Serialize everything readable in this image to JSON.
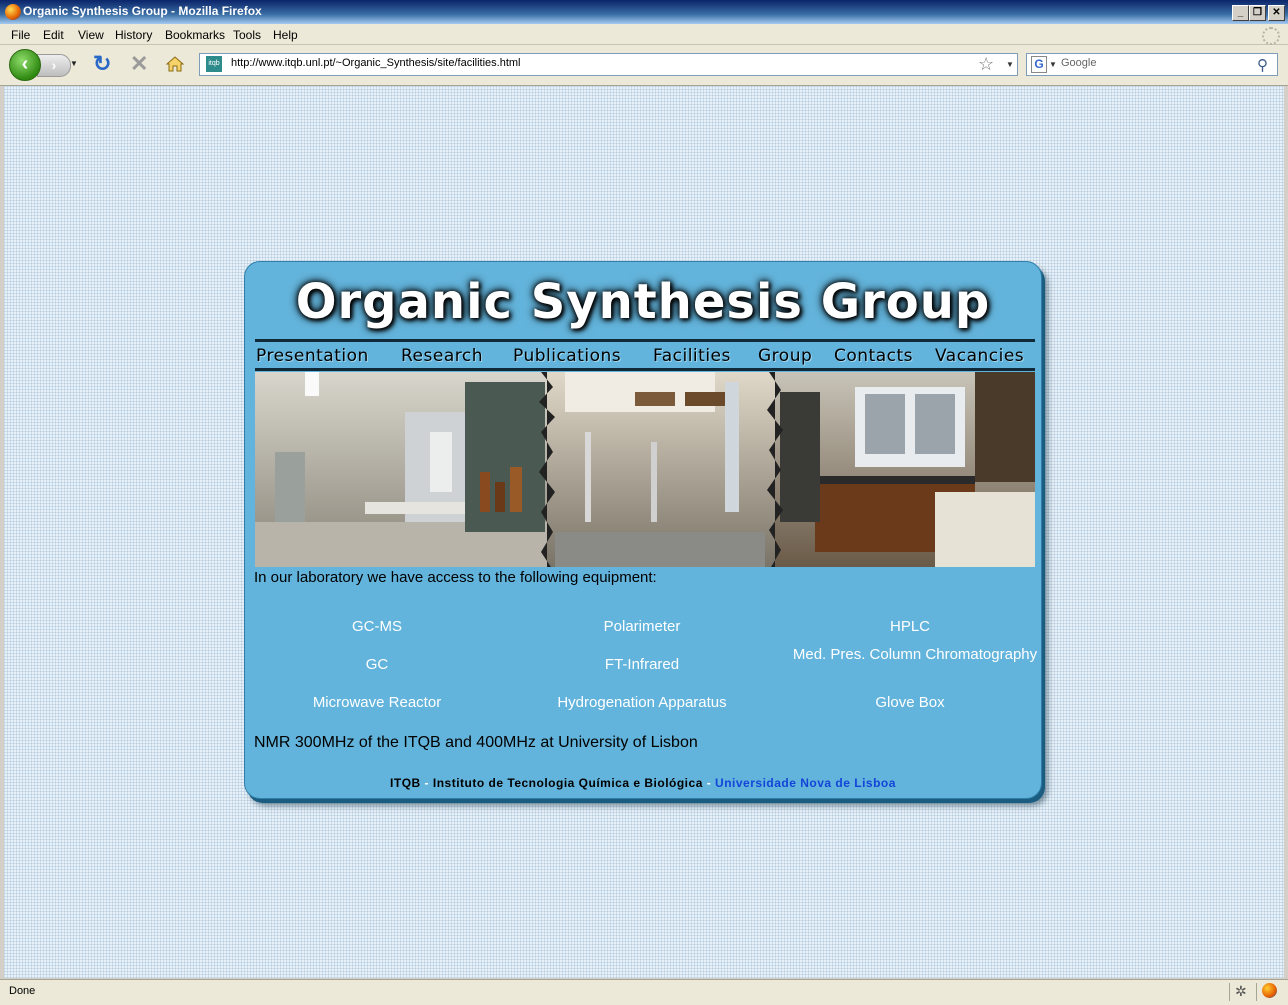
{
  "window": {
    "title": "Organic Synthesis Group - Mozilla Firefox"
  },
  "menu": [
    "File",
    "Edit",
    "View",
    "History",
    "Bookmarks",
    "Tools",
    "Help"
  ],
  "nav": {
    "url": "http://www.itqb.unl.pt/~Organic_Synthesis/site/facilities.html",
    "site_icon_text": "itqb",
    "search_placeholder": "Google",
    "search_engine": "G"
  },
  "page": {
    "title": "Organic Synthesis Group",
    "links": [
      "Presentation",
      "Research",
      "Publications",
      "Facilities",
      "Group",
      "Contacts",
      "Vacancies"
    ],
    "intro": "In our laboratory we have access to the following equipment:",
    "equipment": [
      [
        "GC-MS",
        "Polarimeter",
        "HPLC"
      ],
      [
        "GC",
        "FT-Infrared",
        "Med. Pres. Column Chromatography"
      ],
      [
        "Microwave Reactor",
        "Hydrogenation Apparatus",
        "Glove Box"
      ]
    ],
    "nmr": "NMR 300MHz of the ITQB and 400MHz at University of Lisbon",
    "footer": {
      "itqb": "ITQB",
      "sep1": " - ",
      "name": "Instituto de Tecnologia Química e Biológica",
      "sep2": " - ",
      "university": "Universidade Nova de Lisboa"
    }
  },
  "status": {
    "text": "Done"
  }
}
